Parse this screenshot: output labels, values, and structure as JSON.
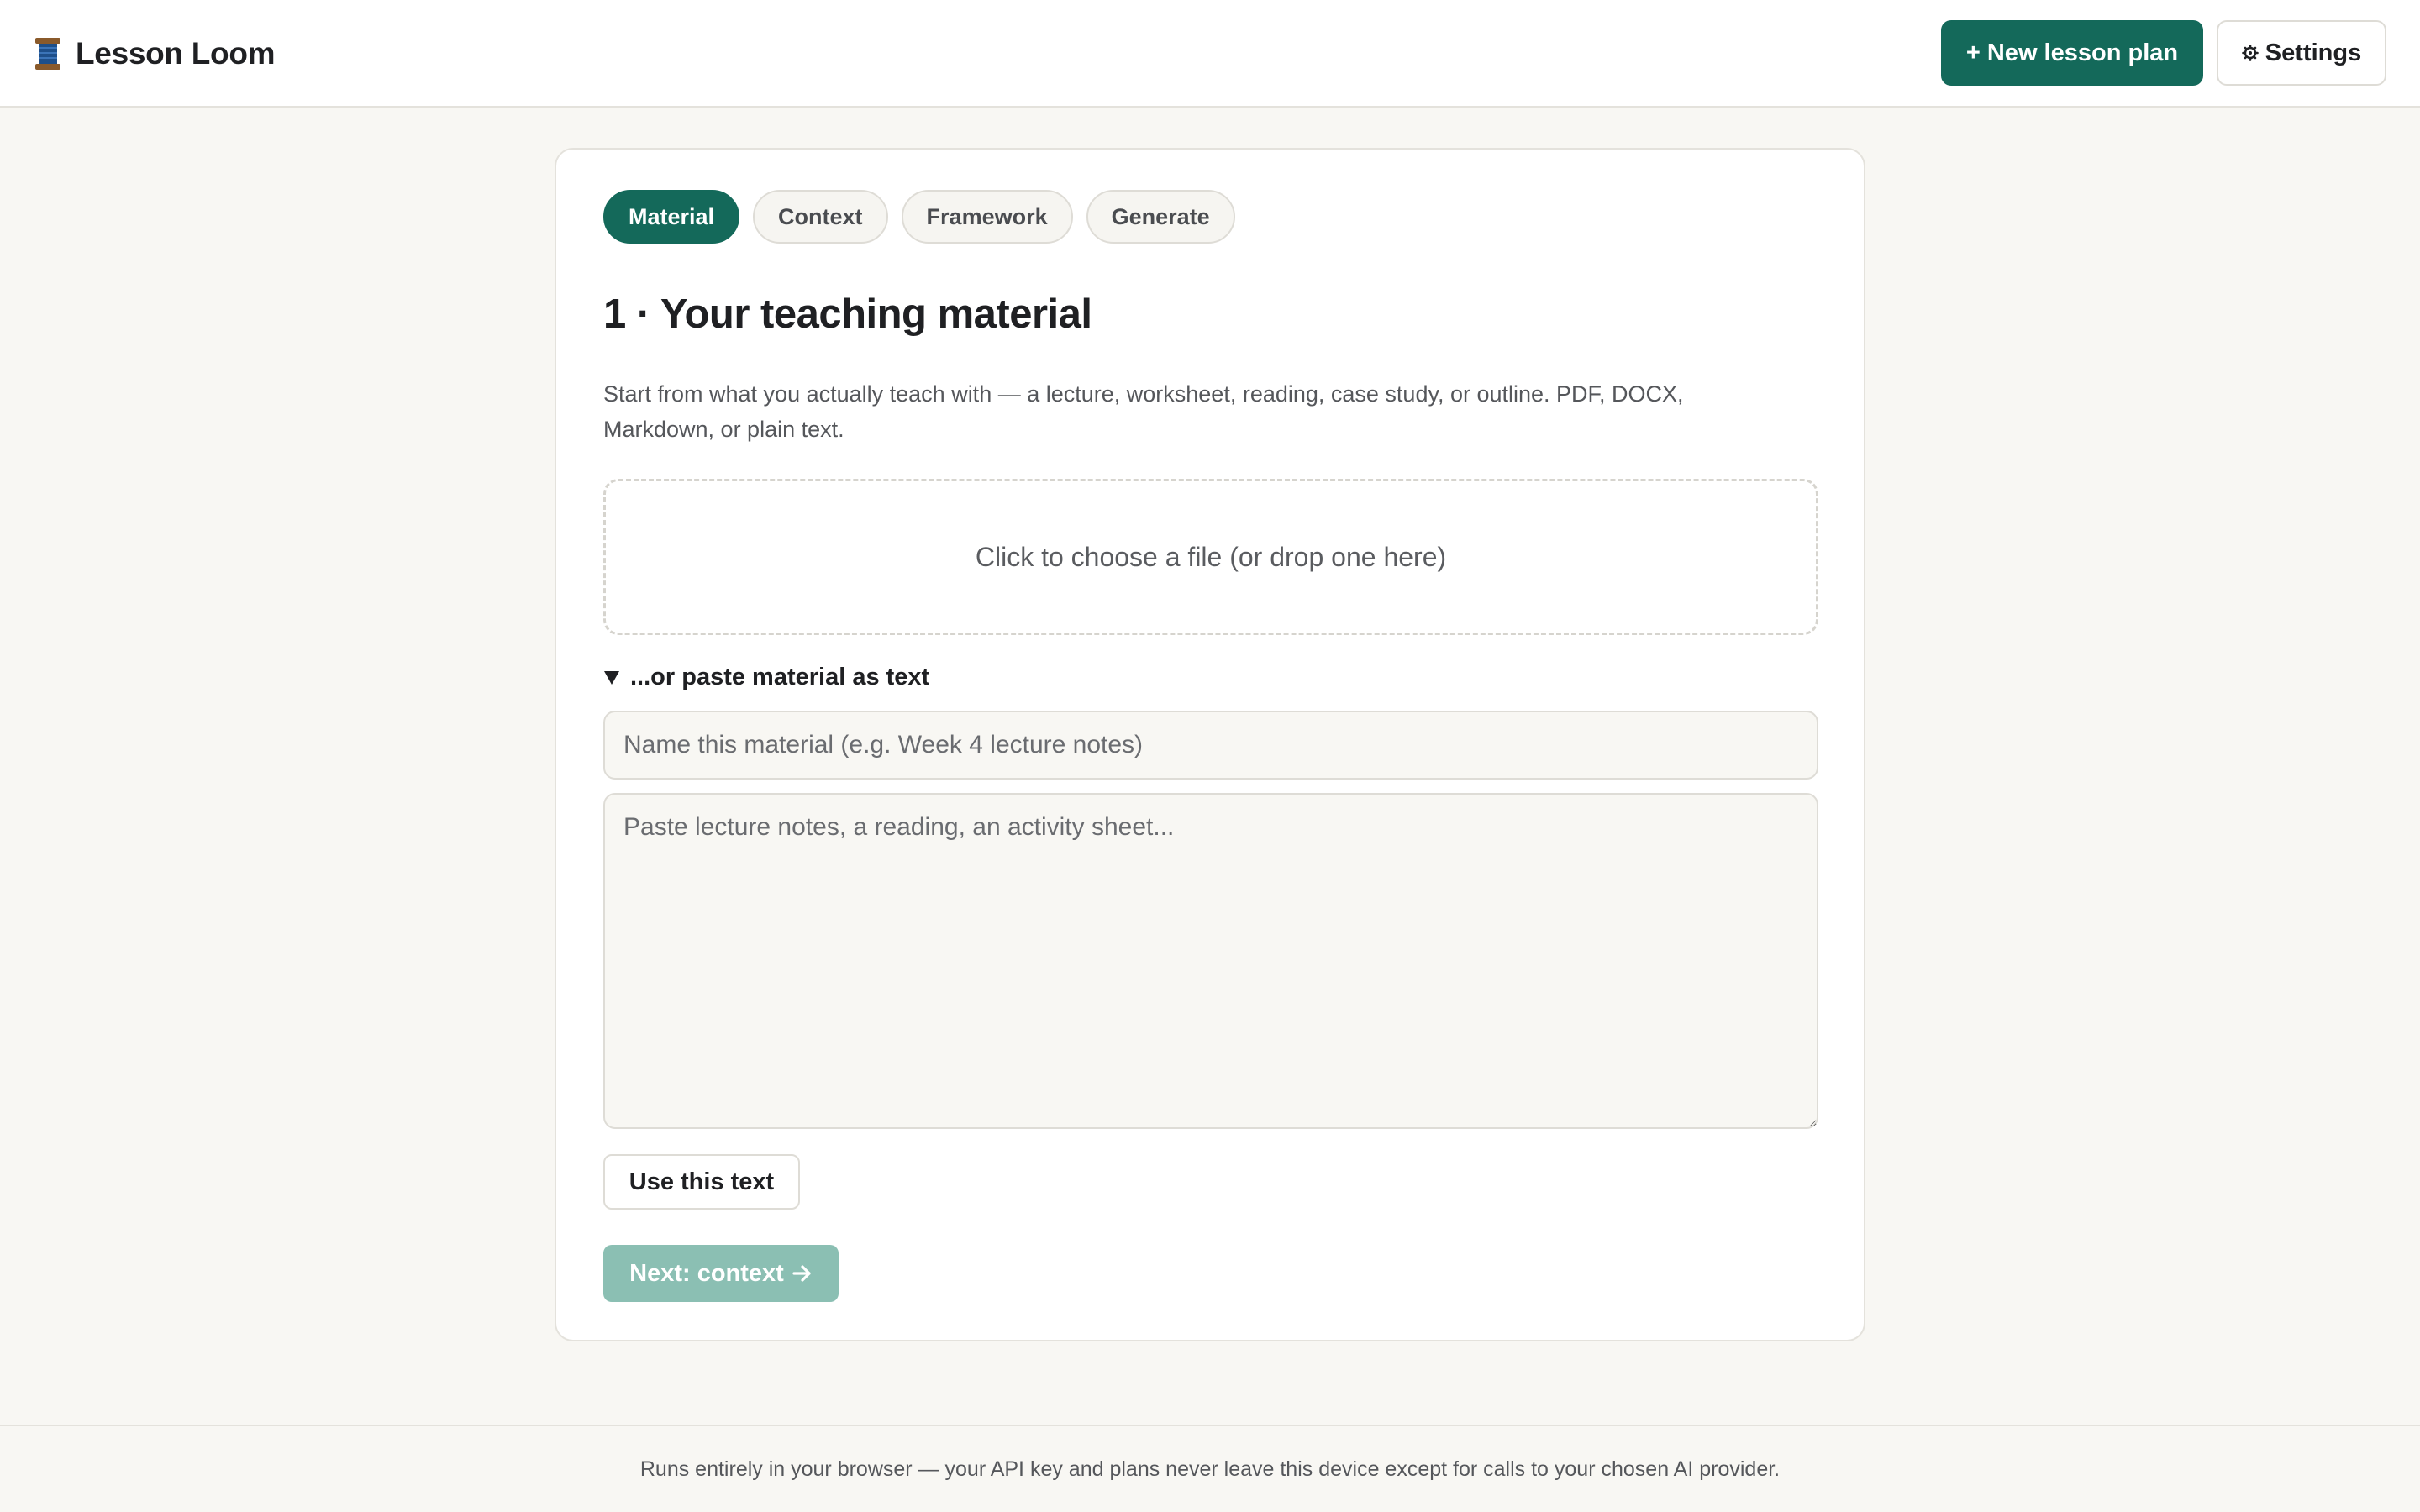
{
  "header": {
    "app_name": "Lesson Loom",
    "logo_icon": "spool-icon",
    "new_plan_label": "+ New lesson plan",
    "settings_label": "Settings",
    "settings_icon": "gear-icon"
  },
  "steps": [
    {
      "label": "Material",
      "active": true
    },
    {
      "label": "Context",
      "active": false
    },
    {
      "label": "Framework",
      "active": false
    },
    {
      "label": "Generate",
      "active": false
    }
  ],
  "main": {
    "title": "1 · Your teaching material",
    "description": "Start from what you actually teach with — a lecture, worksheet, reading, case study, or outline. PDF, DOCX, Markdown, or plain text.",
    "dropzone_label": "Click to choose a file (or drop one here)",
    "paste_toggle_label": "...or paste material as text",
    "name_placeholder": "Name this material (e.g. Week 4 lecture notes)",
    "name_value": "",
    "text_placeholder": "Paste lecture notes, a reading, an activity sheet...",
    "text_value": "",
    "use_text_label": "Use this text",
    "next_label": "Next: context",
    "next_enabled": false
  },
  "footer": {
    "note": "Runs entirely in your browser — your API key and plans never leave this device except for calls to your chosen AI provider."
  },
  "colors": {
    "accent": "#14695a",
    "accent_disabled": "#8bbfb3",
    "background": "#f8f7f3"
  }
}
